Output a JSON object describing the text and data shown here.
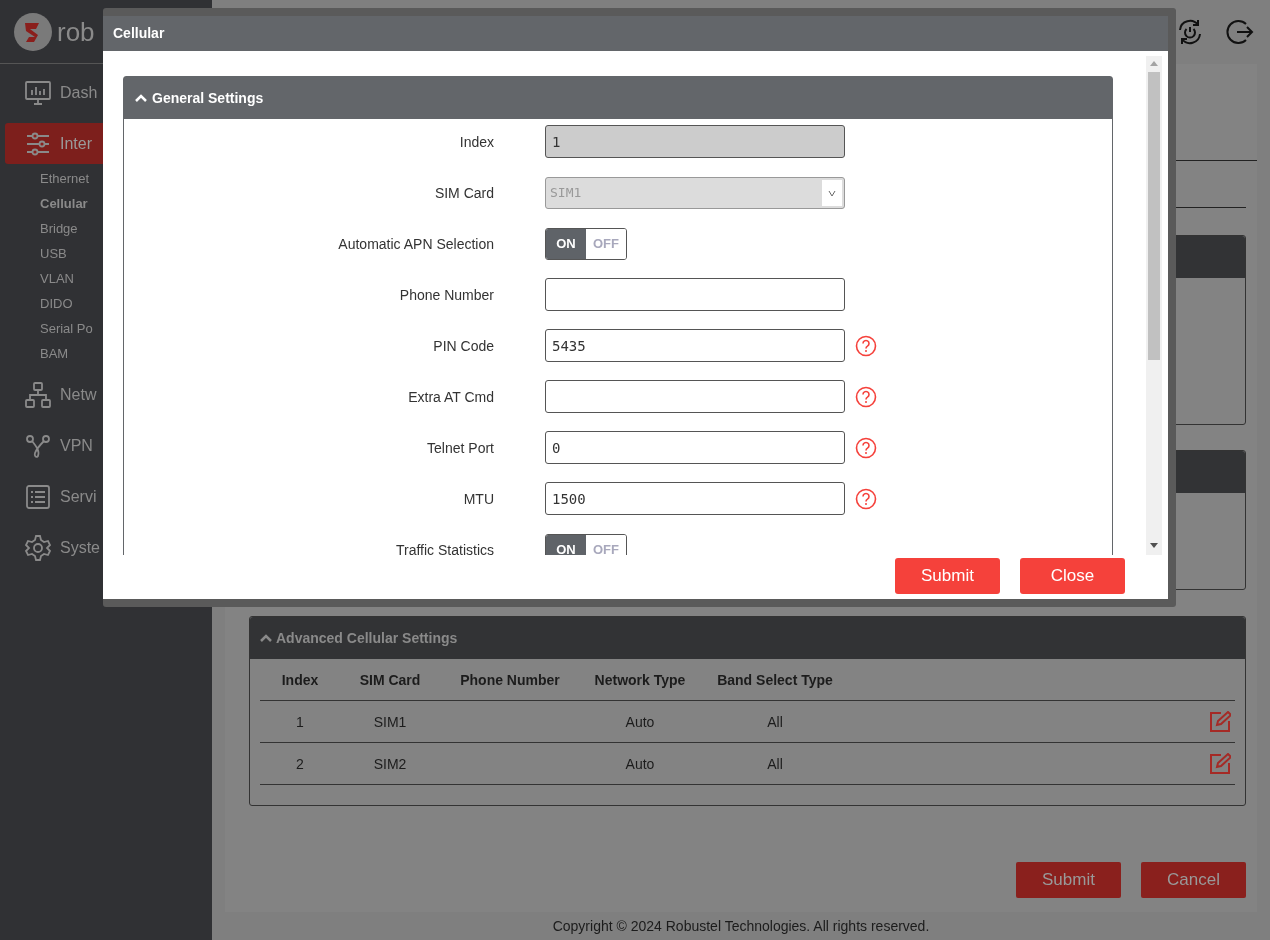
{
  "brand": {
    "logo_text": "rob"
  },
  "sidebar": {
    "items": [
      {
        "label": "Dash",
        "selected": false
      },
      {
        "label": "Inter",
        "selected": true,
        "children": [
          {
            "label": "Ethernet",
            "selected": false
          },
          {
            "label": "Cellular",
            "selected": true
          },
          {
            "label": "Bridge",
            "selected": false
          },
          {
            "label": "USB",
            "selected": false
          },
          {
            "label": "VLAN",
            "selected": false
          },
          {
            "label": "DIDO",
            "selected": false
          },
          {
            "label": "Serial Po",
            "selected": false
          },
          {
            "label": "BAM",
            "selected": false
          }
        ]
      },
      {
        "label": "Netw",
        "selected": false
      },
      {
        "label": "VPN",
        "selected": false
      },
      {
        "label": "Servi",
        "selected": false
      },
      {
        "label": "Syste",
        "selected": false
      }
    ]
  },
  "advanced_panel": {
    "title": "Advanced Cellular Settings",
    "columns": [
      "Index",
      "SIM Card",
      "Phone Number",
      "Network Type",
      "Band Select Type"
    ],
    "rows": [
      {
        "cells": [
          "1",
          "SIM1",
          "",
          "Auto",
          "All"
        ]
      },
      {
        "cells": [
          "2",
          "SIM2",
          "",
          "Auto",
          "All"
        ]
      }
    ]
  },
  "page_buttons": [
    "Submit",
    "Cancel"
  ],
  "footer": "Copyright © 2024 Robustel Technologies. All rights reserved.",
  "dialog": {
    "title": "Cellular",
    "panel_title": "General Settings",
    "fields": [
      {
        "kind": "input",
        "label": "Index",
        "value": "1",
        "disabled": true,
        "help": false
      },
      {
        "kind": "select",
        "label": "SIM Card",
        "value": "SIM1",
        "disabled": true,
        "help": false
      },
      {
        "kind": "toggle",
        "label": "Automatic APN Selection",
        "on": true,
        "on_text": "ON",
        "off_text": "OFF"
      },
      {
        "kind": "input",
        "label": "Phone Number",
        "disabled": false,
        "help": false
      },
      {
        "kind": "input",
        "label": "PIN Code",
        "value": "5435",
        "disabled": false,
        "help": true
      },
      {
        "kind": "input",
        "label": "Extra AT Cmd",
        "disabled": false,
        "help": true
      },
      {
        "kind": "input",
        "label": "Telnet Port",
        "value": "0",
        "disabled": false,
        "help": true
      },
      {
        "kind": "input",
        "label": "MTU",
        "value": "1500",
        "disabled": false,
        "help": true
      },
      {
        "kind": "toggle",
        "label": "Traffic Statistics",
        "on": true,
        "on_text": "ON",
        "off_text": "OFF"
      }
    ],
    "buttons": [
      "Submit",
      "Close"
    ]
  }
}
